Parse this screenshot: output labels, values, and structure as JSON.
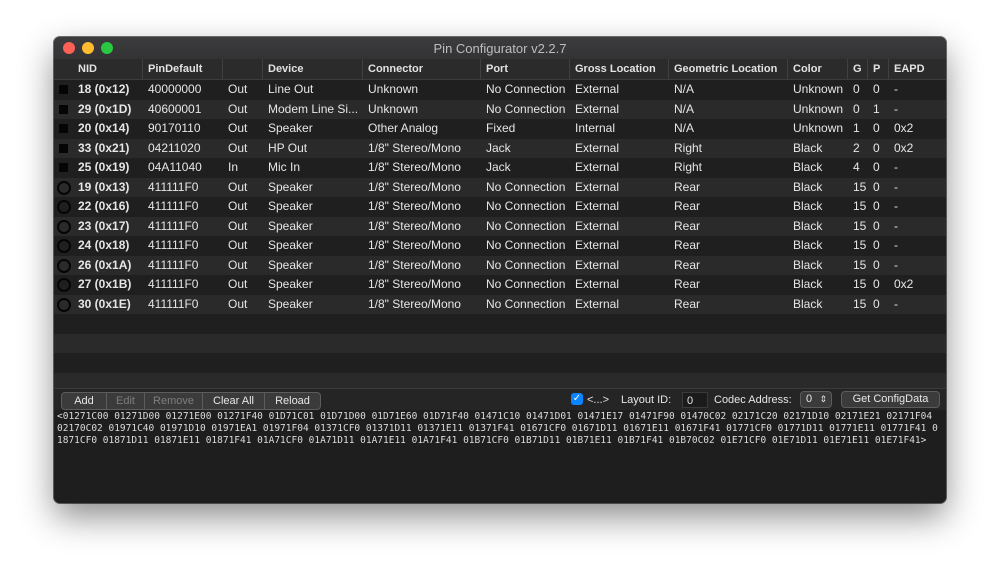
{
  "window": {
    "title": "Pin Configurator v2.2.7"
  },
  "table": {
    "columns": [
      "NID",
      "PinDefault",
      "",
      "Device",
      "Connector",
      "Port",
      "Gross Location",
      "Geometric Location",
      "Color",
      "G",
      "P",
      "EAPD"
    ],
    "rows": [
      {
        "marker": "square",
        "nid": "18 (0x12)",
        "pin_default": "40000000",
        "dir": "Out",
        "device": "Line Out",
        "connector": "Unknown",
        "port": "No Connection",
        "gross_location": "External",
        "geometric_location": "N/A",
        "color": "Unknown",
        "g": "0",
        "p": "0",
        "eapd": "-"
      },
      {
        "marker": "square",
        "nid": "29 (0x1D)",
        "pin_default": "40600001",
        "dir": "Out",
        "device": "Modem Line Si...",
        "connector": "Unknown",
        "port": "No Connection",
        "gross_location": "External",
        "geometric_location": "N/A",
        "color": "Unknown",
        "g": "0",
        "p": "1",
        "eapd": "-"
      },
      {
        "marker": "square",
        "nid": "20 (0x14)",
        "pin_default": "90170110",
        "dir": "Out",
        "device": "Speaker",
        "connector": "Other Analog",
        "port": "Fixed",
        "gross_location": "Internal",
        "geometric_location": "N/A",
        "color": "Unknown",
        "g": "1",
        "p": "0",
        "eapd": "0x2"
      },
      {
        "marker": "square",
        "nid": "33 (0x21)",
        "pin_default": "04211020",
        "dir": "Out",
        "device": "HP Out",
        "connector": "1/8\" Stereo/Mono",
        "port": "Jack",
        "gross_location": "External",
        "geometric_location": "Right",
        "color": "Black",
        "g": "2",
        "p": "0",
        "eapd": "0x2"
      },
      {
        "marker": "square",
        "nid": "25 (0x19)",
        "pin_default": "04A11040",
        "dir": "In",
        "device": "Mic In",
        "connector": "1/8\" Stereo/Mono",
        "port": "Jack",
        "gross_location": "External",
        "geometric_location": "Right",
        "color": "Black",
        "g": "4",
        "p": "0",
        "eapd": "-"
      },
      {
        "marker": "circle",
        "nid": "19 (0x13)",
        "pin_default": "411111F0",
        "dir": "Out",
        "device": "Speaker",
        "connector": "1/8\" Stereo/Mono",
        "port": "No Connection",
        "gross_location": "External",
        "geometric_location": "Rear",
        "color": "Black",
        "g": "15",
        "p": "0",
        "eapd": "-"
      },
      {
        "marker": "circle",
        "nid": "22 (0x16)",
        "pin_default": "411111F0",
        "dir": "Out",
        "device": "Speaker",
        "connector": "1/8\" Stereo/Mono",
        "port": "No Connection",
        "gross_location": "External",
        "geometric_location": "Rear",
        "color": "Black",
        "g": "15",
        "p": "0",
        "eapd": "-"
      },
      {
        "marker": "circle",
        "nid": "23 (0x17)",
        "pin_default": "411111F0",
        "dir": "Out",
        "device": "Speaker",
        "connector": "1/8\" Stereo/Mono",
        "port": "No Connection",
        "gross_location": "External",
        "geometric_location": "Rear",
        "color": "Black",
        "g": "15",
        "p": "0",
        "eapd": "-"
      },
      {
        "marker": "circle",
        "nid": "24 (0x18)",
        "pin_default": "411111F0",
        "dir": "Out",
        "device": "Speaker",
        "connector": "1/8\" Stereo/Mono",
        "port": "No Connection",
        "gross_location": "External",
        "geometric_location": "Rear",
        "color": "Black",
        "g": "15",
        "p": "0",
        "eapd": "-"
      },
      {
        "marker": "circle",
        "nid": "26 (0x1A)",
        "pin_default": "411111F0",
        "dir": "Out",
        "device": "Speaker",
        "connector": "1/8\" Stereo/Mono",
        "port": "No Connection",
        "gross_location": "External",
        "geometric_location": "Rear",
        "color": "Black",
        "g": "15",
        "p": "0",
        "eapd": "-"
      },
      {
        "marker": "circle",
        "nid": "27 (0x1B)",
        "pin_default": "411111F0",
        "dir": "Out",
        "device": "Speaker",
        "connector": "1/8\" Stereo/Mono",
        "port": "No Connection",
        "gross_location": "External",
        "geometric_location": "Rear",
        "color": "Black",
        "g": "15",
        "p": "0",
        "eapd": "0x2"
      },
      {
        "marker": "circle",
        "nid": "30 (0x1E)",
        "pin_default": "411111F0",
        "dir": "Out",
        "device": "Speaker",
        "connector": "1/8\" Stereo/Mono",
        "port": "No Connection",
        "gross_location": "External",
        "geometric_location": "Rear",
        "color": "Black",
        "g": "15",
        "p": "0",
        "eapd": "-"
      }
    ]
  },
  "toolbar": {
    "buttons": [
      {
        "label": "Add",
        "enabled": true
      },
      {
        "label": "Edit",
        "enabled": false
      },
      {
        "label": "Remove",
        "enabled": false
      },
      {
        "label": "Clear All",
        "enabled": true
      },
      {
        "label": "Reload",
        "enabled": true
      }
    ],
    "checkbox_checked": true,
    "checkbox_label": "<...>",
    "layout_id_label": "Layout ID:",
    "layout_id_value": "0",
    "codec_address_label": "Codec Address:",
    "codec_address_value": "0",
    "get_config_label": "Get ConfigData"
  },
  "config_data": "<01271C00 01271D00 01271E00 01271F40 01D71C01 01D71D00 01D71E60 01D71F40 01471C10 01471D01 01471E17 01471F90 01470C02 02171C20 02171D10 02171E21 02171F04 02170C02 01971C40 01971D10 01971EA1 01971F04 01371CF0 01371D11 01371E11 01371F41 01671CF0 01671D11 01671E11 01671F41 01771CF0 01771D11 01771E11 01771F41 01871CF0 01871D11 01871E11 01871F41 01A71CF0 01A71D11 01A71E11 01A71F41 01B71CF0 01B71D11 01B71E11 01B71F41 01B70C02 01E71CF0 01E71D11 01E71E11 01E71F41>",
  "colors": {
    "close": "#fe5f57",
    "minimize": "#febc2e",
    "zoom": "#28c840",
    "accent": "#0a84ff"
  }
}
